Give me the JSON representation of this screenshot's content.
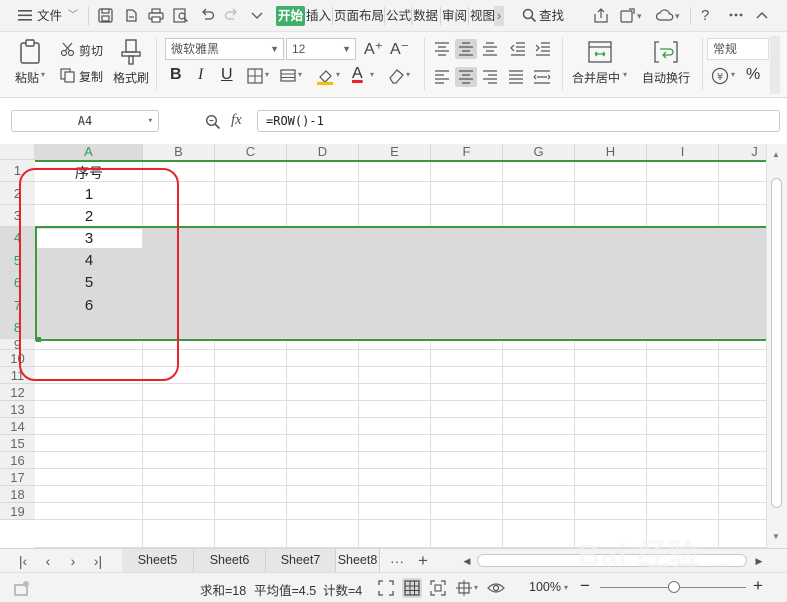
{
  "menubar": {
    "file_label": "文件",
    "tabs": [
      "开始",
      "插入",
      "页面布局",
      "公式",
      "数据",
      "审阅",
      "视图"
    ],
    "more_label": "›",
    "search_label": "查找",
    "help_label": "?"
  },
  "ribbon": {
    "paste_label": "粘贴",
    "cut_label": "剪切",
    "copy_label": "复制",
    "format_painter_label": "格式刷",
    "font_name": "微软雅黑",
    "font_size": "12",
    "merge_center_label": "合并居中",
    "wrap_text_label": "自动换行",
    "number_format": "常规",
    "percent_label": "%",
    "bold_label": "B",
    "italic_label": "I",
    "underline_label": "U",
    "font_color_label": "A",
    "grow_font_label": "A⁺",
    "shrink_font_label": "A⁻"
  },
  "formula_bar": {
    "name_box": "A4",
    "fx_label": "fx",
    "formula": "=ROW()-1"
  },
  "grid": {
    "columns": [
      "A",
      "B",
      "C",
      "D",
      "E",
      "F",
      "G",
      "H",
      "I",
      "J"
    ],
    "selected_column": "A",
    "rows": [
      "1",
      "2",
      "3",
      "4",
      "5",
      "6",
      "7",
      "8",
      "9",
      "10",
      "11",
      "12",
      "13",
      "14",
      "15",
      "16",
      "17",
      "18",
      "19"
    ],
    "selected_rows": [
      "4",
      "5",
      "6",
      "7",
      "8"
    ],
    "active_cell": "A4",
    "cells": {
      "A1": "序号",
      "A2": "1",
      "A3": "2",
      "A4": "3",
      "A5": "4",
      "A6": "5",
      "A7": "6"
    }
  },
  "sheet_tabs": {
    "tabs": [
      "Sheet5",
      "Sheet6",
      "Sheet7",
      "Sheet8"
    ],
    "more_label": "···",
    "add_label": "+"
  },
  "statusbar": {
    "sum_label": "求和=18",
    "average_label": "平均值=4.5",
    "count_label": "计数=4",
    "zoom_label": "100%",
    "zoom_minus": "−",
    "zoom_plus": "+",
    "zoom_level_percent": 100
  },
  "watermark": {
    "text": "Bai 经验",
    "sub": "jingyan.baidu.com"
  },
  "colors": {
    "accent_green": "#3faf6a",
    "selection_green": "#3a9a3f",
    "annotation_red": "#e8232b"
  }
}
